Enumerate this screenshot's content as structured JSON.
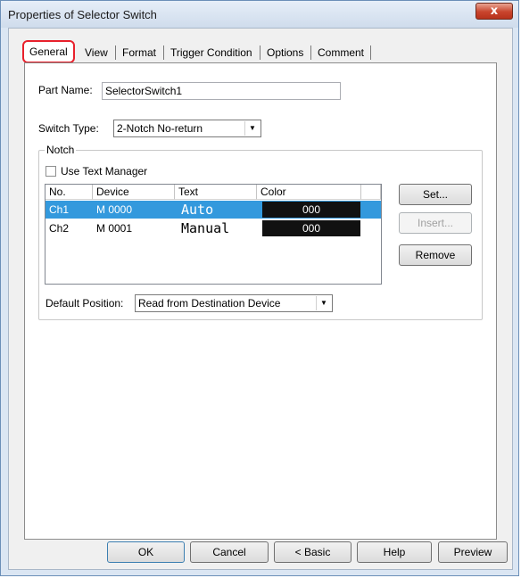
{
  "window": {
    "title": "Properties of Selector Switch",
    "close_label": "x"
  },
  "tabs": [
    {
      "label": "General",
      "active": true
    },
    {
      "label": "View"
    },
    {
      "label": "Format"
    },
    {
      "label": "Trigger Condition"
    },
    {
      "label": "Options"
    },
    {
      "label": "Comment"
    }
  ],
  "general": {
    "part_name_label": "Part Name:",
    "part_name_value": "SelectorSwitch1",
    "switch_type_label": "Switch Type:",
    "switch_type_value": "2-Notch No-return",
    "notch_group_label": "Notch",
    "use_text_manager_label": "Use Text Manager",
    "use_text_manager_checked": false,
    "table_headers": [
      "No.",
      "Device",
      "Text",
      "Color"
    ],
    "rows": [
      {
        "no": "Ch1",
        "device": "M 0000",
        "text": "Auto",
        "color": "000",
        "selected": true
      },
      {
        "no": "Ch2",
        "device": "M 0001",
        "text": "Manual",
        "color": "000",
        "selected": false
      }
    ],
    "set_label": "Set...",
    "insert_label": "Insert...",
    "remove_label": "Remove",
    "default_position_label": "Default Position:",
    "default_position_value": "Read from Destination Device"
  },
  "buttons": {
    "ok": "OK",
    "cancel": "Cancel",
    "basic": "< Basic",
    "help": "Help",
    "preview": "Preview"
  },
  "colors": {
    "selection": "#3399dd",
    "swatch": "#111111",
    "active_tab_highlight": "#e8212c"
  }
}
